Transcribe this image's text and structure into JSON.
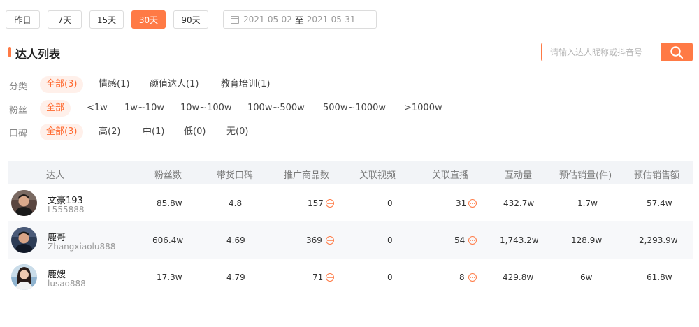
{
  "ranges": [
    "昨日",
    "7天",
    "15天",
    "30天",
    "90天"
  ],
  "date_range": {
    "start": "2021-05-02",
    "sep": "至",
    "end": "2021-05-31"
  },
  "section_title": "达人列表",
  "search": {
    "placeholder": "请输入达人昵称或抖音号"
  },
  "filters": {
    "category": {
      "label": "分类",
      "options": [
        "全部(3)",
        "情感(1)",
        "颜值达人(1)",
        "教育培训(1)"
      ]
    },
    "fans": {
      "label": "粉丝",
      "options": [
        "全部",
        "<1w",
        "1w~10w",
        "10w~100w",
        "100w~500w",
        "500w~1000w",
        ">1000w"
      ]
    },
    "reputation": {
      "label": "口碑",
      "options": [
        "全部(3)",
        "高(2)",
        "中(1)",
        "低(0)",
        "无(0)"
      ]
    }
  },
  "table": {
    "headers": [
      "达人",
      "粉丝数",
      "带货口碑",
      "推广商品数",
      "关联视频",
      "关联直播",
      "互动量",
      "预估销量(件)",
      "预估销售额"
    ],
    "rows": [
      {
        "name": "文豪193",
        "uid": "L555888",
        "fans": "85.8w",
        "rating": "4.8",
        "products": "157",
        "videos": "0",
        "lives": "31",
        "interactions": "432.7w",
        "sales_qty": "1.7w",
        "sales_amt": "57.4w"
      },
      {
        "name": "鹿哥",
        "uid": "Zhangxiaolu888",
        "fans": "606.4w",
        "rating": "4.69",
        "products": "369",
        "videos": "0",
        "lives": "54",
        "interactions": "1,743.2w",
        "sales_qty": "128.9w",
        "sales_amt": "2,293.9w"
      },
      {
        "name": "鹿嫂",
        "uid": "lusao888",
        "fans": "17.3w",
        "rating": "4.79",
        "products": "71",
        "videos": "0",
        "lives": "8",
        "interactions": "429.8w",
        "sales_qty": "6w",
        "sales_amt": "61.8w"
      }
    ]
  },
  "colors": {
    "accent": "#ff7a45"
  }
}
